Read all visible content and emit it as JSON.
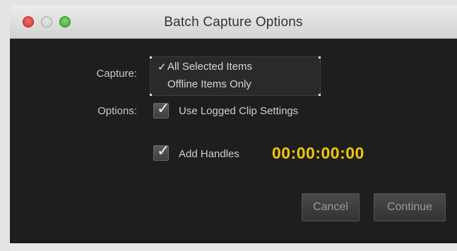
{
  "window": {
    "title": "Batch Capture Options"
  },
  "capture": {
    "label": "Capture:",
    "options": [
      {
        "label": "All Selected Items",
        "checked": true,
        "check_glyph": "✓"
      },
      {
        "label": "Offline Items Only",
        "checked": false
      }
    ]
  },
  "options": {
    "label": "Options:",
    "use_logged_clip_settings": {
      "label": "Use Logged Clip Settings",
      "checked": true
    },
    "add_handles": {
      "label": "Add Handles",
      "checked": true,
      "timecode": "00:00:00:00"
    }
  },
  "buttons": {
    "cancel": "Cancel",
    "continue": "Continue"
  },
  "colors": {
    "timecode": "#f2c40a",
    "panel_background": "#1e1e1e",
    "close_button": "#e0443e",
    "zoom_button": "#4fbf3e"
  },
  "icons": {
    "checkbox_tick": "✓"
  }
}
